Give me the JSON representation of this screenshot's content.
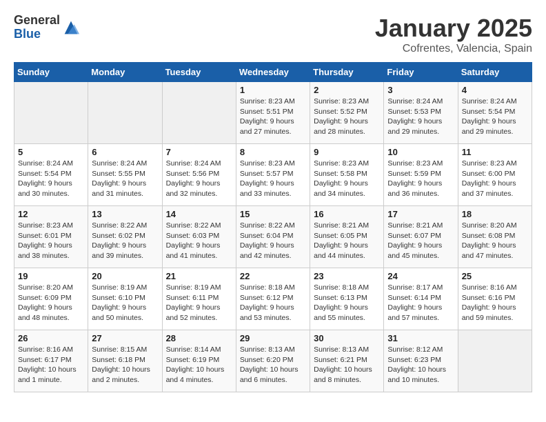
{
  "logo": {
    "general": "General",
    "blue": "Blue"
  },
  "title": "January 2025",
  "subtitle": "Cofrentes, Valencia, Spain",
  "days_of_week": [
    "Sunday",
    "Monday",
    "Tuesday",
    "Wednesday",
    "Thursday",
    "Friday",
    "Saturday"
  ],
  "weeks": [
    [
      {
        "day": "",
        "info": ""
      },
      {
        "day": "",
        "info": ""
      },
      {
        "day": "",
        "info": ""
      },
      {
        "day": "1",
        "info": "Sunrise: 8:23 AM\nSunset: 5:51 PM\nDaylight: 9 hours\nand 27 minutes."
      },
      {
        "day": "2",
        "info": "Sunrise: 8:23 AM\nSunset: 5:52 PM\nDaylight: 9 hours\nand 28 minutes."
      },
      {
        "day": "3",
        "info": "Sunrise: 8:24 AM\nSunset: 5:53 PM\nDaylight: 9 hours\nand 29 minutes."
      },
      {
        "day": "4",
        "info": "Sunrise: 8:24 AM\nSunset: 5:54 PM\nDaylight: 9 hours\nand 29 minutes."
      }
    ],
    [
      {
        "day": "5",
        "info": "Sunrise: 8:24 AM\nSunset: 5:54 PM\nDaylight: 9 hours\nand 30 minutes."
      },
      {
        "day": "6",
        "info": "Sunrise: 8:24 AM\nSunset: 5:55 PM\nDaylight: 9 hours\nand 31 minutes."
      },
      {
        "day": "7",
        "info": "Sunrise: 8:24 AM\nSunset: 5:56 PM\nDaylight: 9 hours\nand 32 minutes."
      },
      {
        "day": "8",
        "info": "Sunrise: 8:23 AM\nSunset: 5:57 PM\nDaylight: 9 hours\nand 33 minutes."
      },
      {
        "day": "9",
        "info": "Sunrise: 8:23 AM\nSunset: 5:58 PM\nDaylight: 9 hours\nand 34 minutes."
      },
      {
        "day": "10",
        "info": "Sunrise: 8:23 AM\nSunset: 5:59 PM\nDaylight: 9 hours\nand 36 minutes."
      },
      {
        "day": "11",
        "info": "Sunrise: 8:23 AM\nSunset: 6:00 PM\nDaylight: 9 hours\nand 37 minutes."
      }
    ],
    [
      {
        "day": "12",
        "info": "Sunrise: 8:23 AM\nSunset: 6:01 PM\nDaylight: 9 hours\nand 38 minutes."
      },
      {
        "day": "13",
        "info": "Sunrise: 8:22 AM\nSunset: 6:02 PM\nDaylight: 9 hours\nand 39 minutes."
      },
      {
        "day": "14",
        "info": "Sunrise: 8:22 AM\nSunset: 6:03 PM\nDaylight: 9 hours\nand 41 minutes."
      },
      {
        "day": "15",
        "info": "Sunrise: 8:22 AM\nSunset: 6:04 PM\nDaylight: 9 hours\nand 42 minutes."
      },
      {
        "day": "16",
        "info": "Sunrise: 8:21 AM\nSunset: 6:05 PM\nDaylight: 9 hours\nand 44 minutes."
      },
      {
        "day": "17",
        "info": "Sunrise: 8:21 AM\nSunset: 6:07 PM\nDaylight: 9 hours\nand 45 minutes."
      },
      {
        "day": "18",
        "info": "Sunrise: 8:20 AM\nSunset: 6:08 PM\nDaylight: 9 hours\nand 47 minutes."
      }
    ],
    [
      {
        "day": "19",
        "info": "Sunrise: 8:20 AM\nSunset: 6:09 PM\nDaylight: 9 hours\nand 48 minutes."
      },
      {
        "day": "20",
        "info": "Sunrise: 8:19 AM\nSunset: 6:10 PM\nDaylight: 9 hours\nand 50 minutes."
      },
      {
        "day": "21",
        "info": "Sunrise: 8:19 AM\nSunset: 6:11 PM\nDaylight: 9 hours\nand 52 minutes."
      },
      {
        "day": "22",
        "info": "Sunrise: 8:18 AM\nSunset: 6:12 PM\nDaylight: 9 hours\nand 53 minutes."
      },
      {
        "day": "23",
        "info": "Sunrise: 8:18 AM\nSunset: 6:13 PM\nDaylight: 9 hours\nand 55 minutes."
      },
      {
        "day": "24",
        "info": "Sunrise: 8:17 AM\nSunset: 6:14 PM\nDaylight: 9 hours\nand 57 minutes."
      },
      {
        "day": "25",
        "info": "Sunrise: 8:16 AM\nSunset: 6:16 PM\nDaylight: 9 hours\nand 59 minutes."
      }
    ],
    [
      {
        "day": "26",
        "info": "Sunrise: 8:16 AM\nSunset: 6:17 PM\nDaylight: 10 hours\nand 1 minute."
      },
      {
        "day": "27",
        "info": "Sunrise: 8:15 AM\nSunset: 6:18 PM\nDaylight: 10 hours\nand 2 minutes."
      },
      {
        "day": "28",
        "info": "Sunrise: 8:14 AM\nSunset: 6:19 PM\nDaylight: 10 hours\nand 4 minutes."
      },
      {
        "day": "29",
        "info": "Sunrise: 8:13 AM\nSunset: 6:20 PM\nDaylight: 10 hours\nand 6 minutes."
      },
      {
        "day": "30",
        "info": "Sunrise: 8:13 AM\nSunset: 6:21 PM\nDaylight: 10 hours\nand 8 minutes."
      },
      {
        "day": "31",
        "info": "Sunrise: 8:12 AM\nSunset: 6:23 PM\nDaylight: 10 hours\nand 10 minutes."
      },
      {
        "day": "",
        "info": ""
      }
    ]
  ]
}
